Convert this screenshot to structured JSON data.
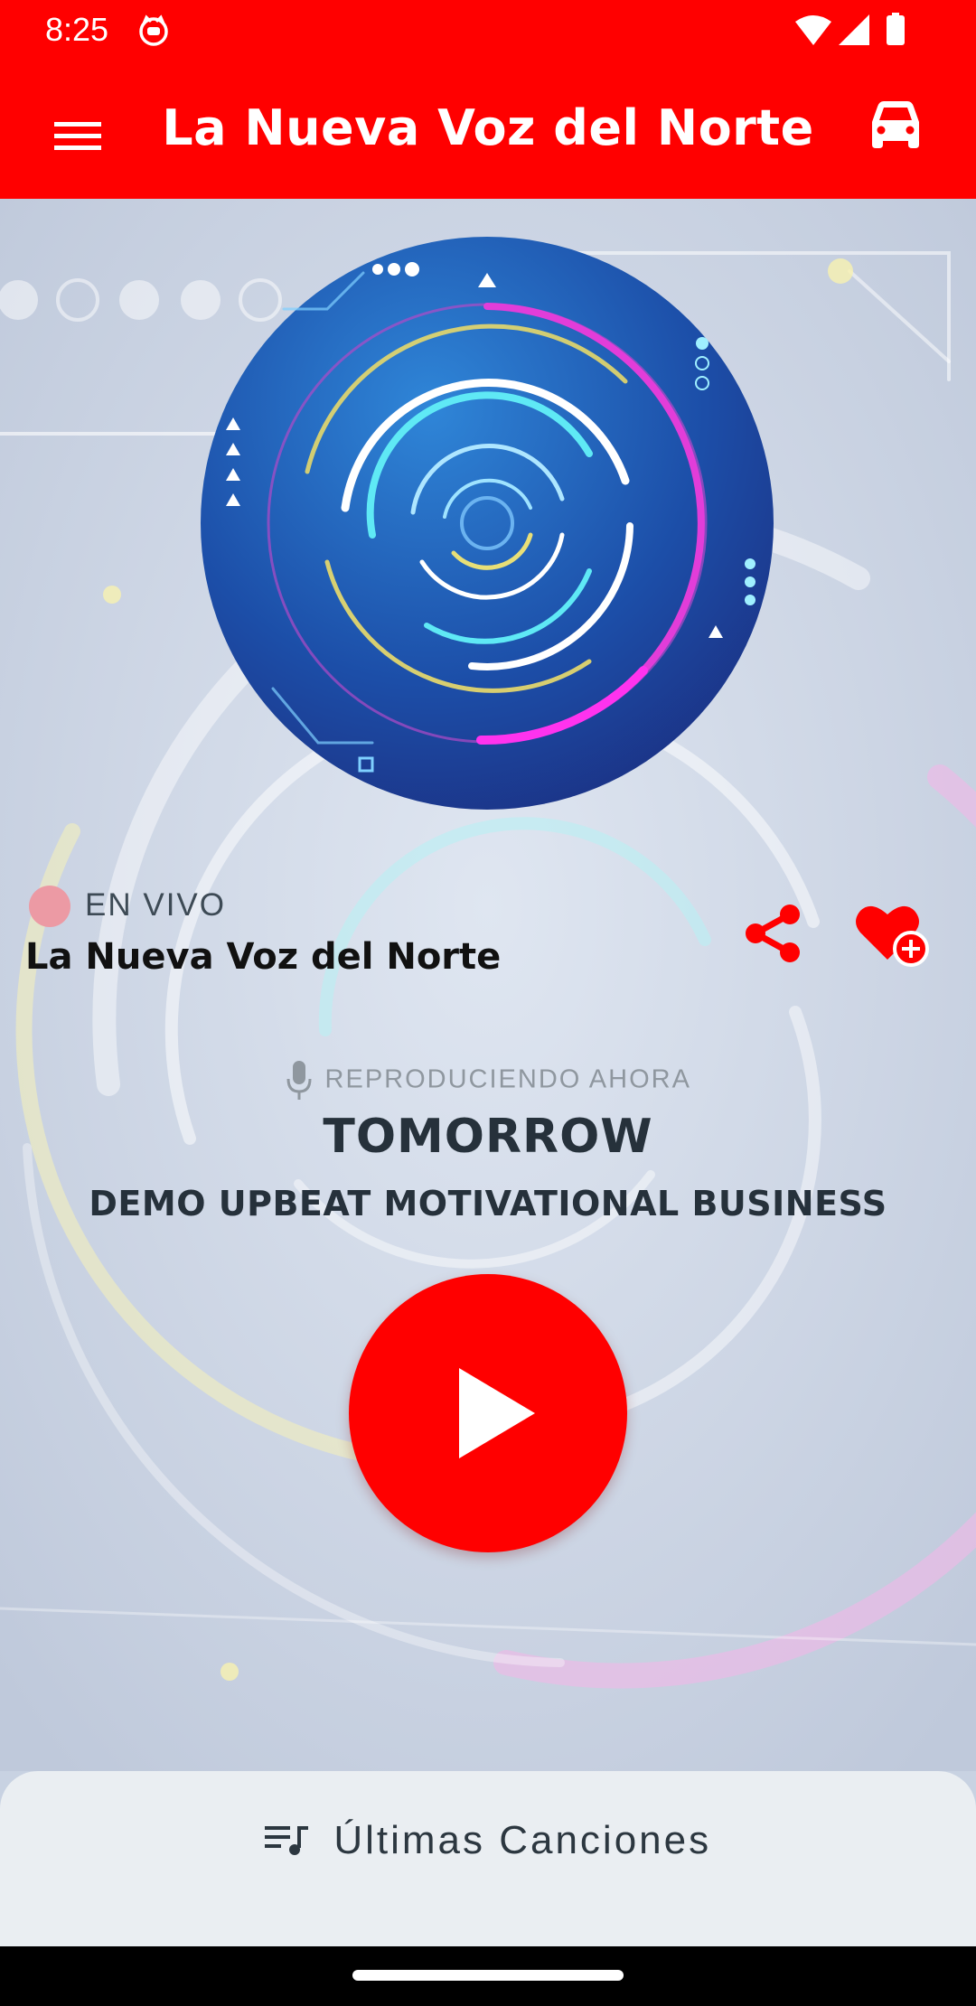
{
  "status_bar": {
    "time": "8:25",
    "icons": [
      "cat-app-icon",
      "wifi-icon",
      "signal-icon",
      "battery-icon"
    ]
  },
  "app_bar": {
    "title": "La Nueva Voz del Norte",
    "left_icon": "menu-icon",
    "right_icon": "car-icon"
  },
  "station": {
    "live_label": "EN VIVO",
    "name": "La Nueva Voz del Norte",
    "actions": [
      "share-icon",
      "favorite-add-icon"
    ]
  },
  "now_playing": {
    "label": "REPRODUCIENDO AHORA",
    "title": "TOMORROW",
    "artist": "DEMO UPBEAT MOTIVATIONAL BUSINESS"
  },
  "player": {
    "state": "paused",
    "button_icon": "play-icon"
  },
  "bottom_sheet": {
    "label": "Últimas Canciones",
    "icon": "playlist-icon"
  },
  "colors": {
    "brand": "#ff0000",
    "background": "#c8d2e2",
    "live_dot": "#ec9aa4",
    "text_dark": "#26313b",
    "sheet": "#eaeef2"
  }
}
